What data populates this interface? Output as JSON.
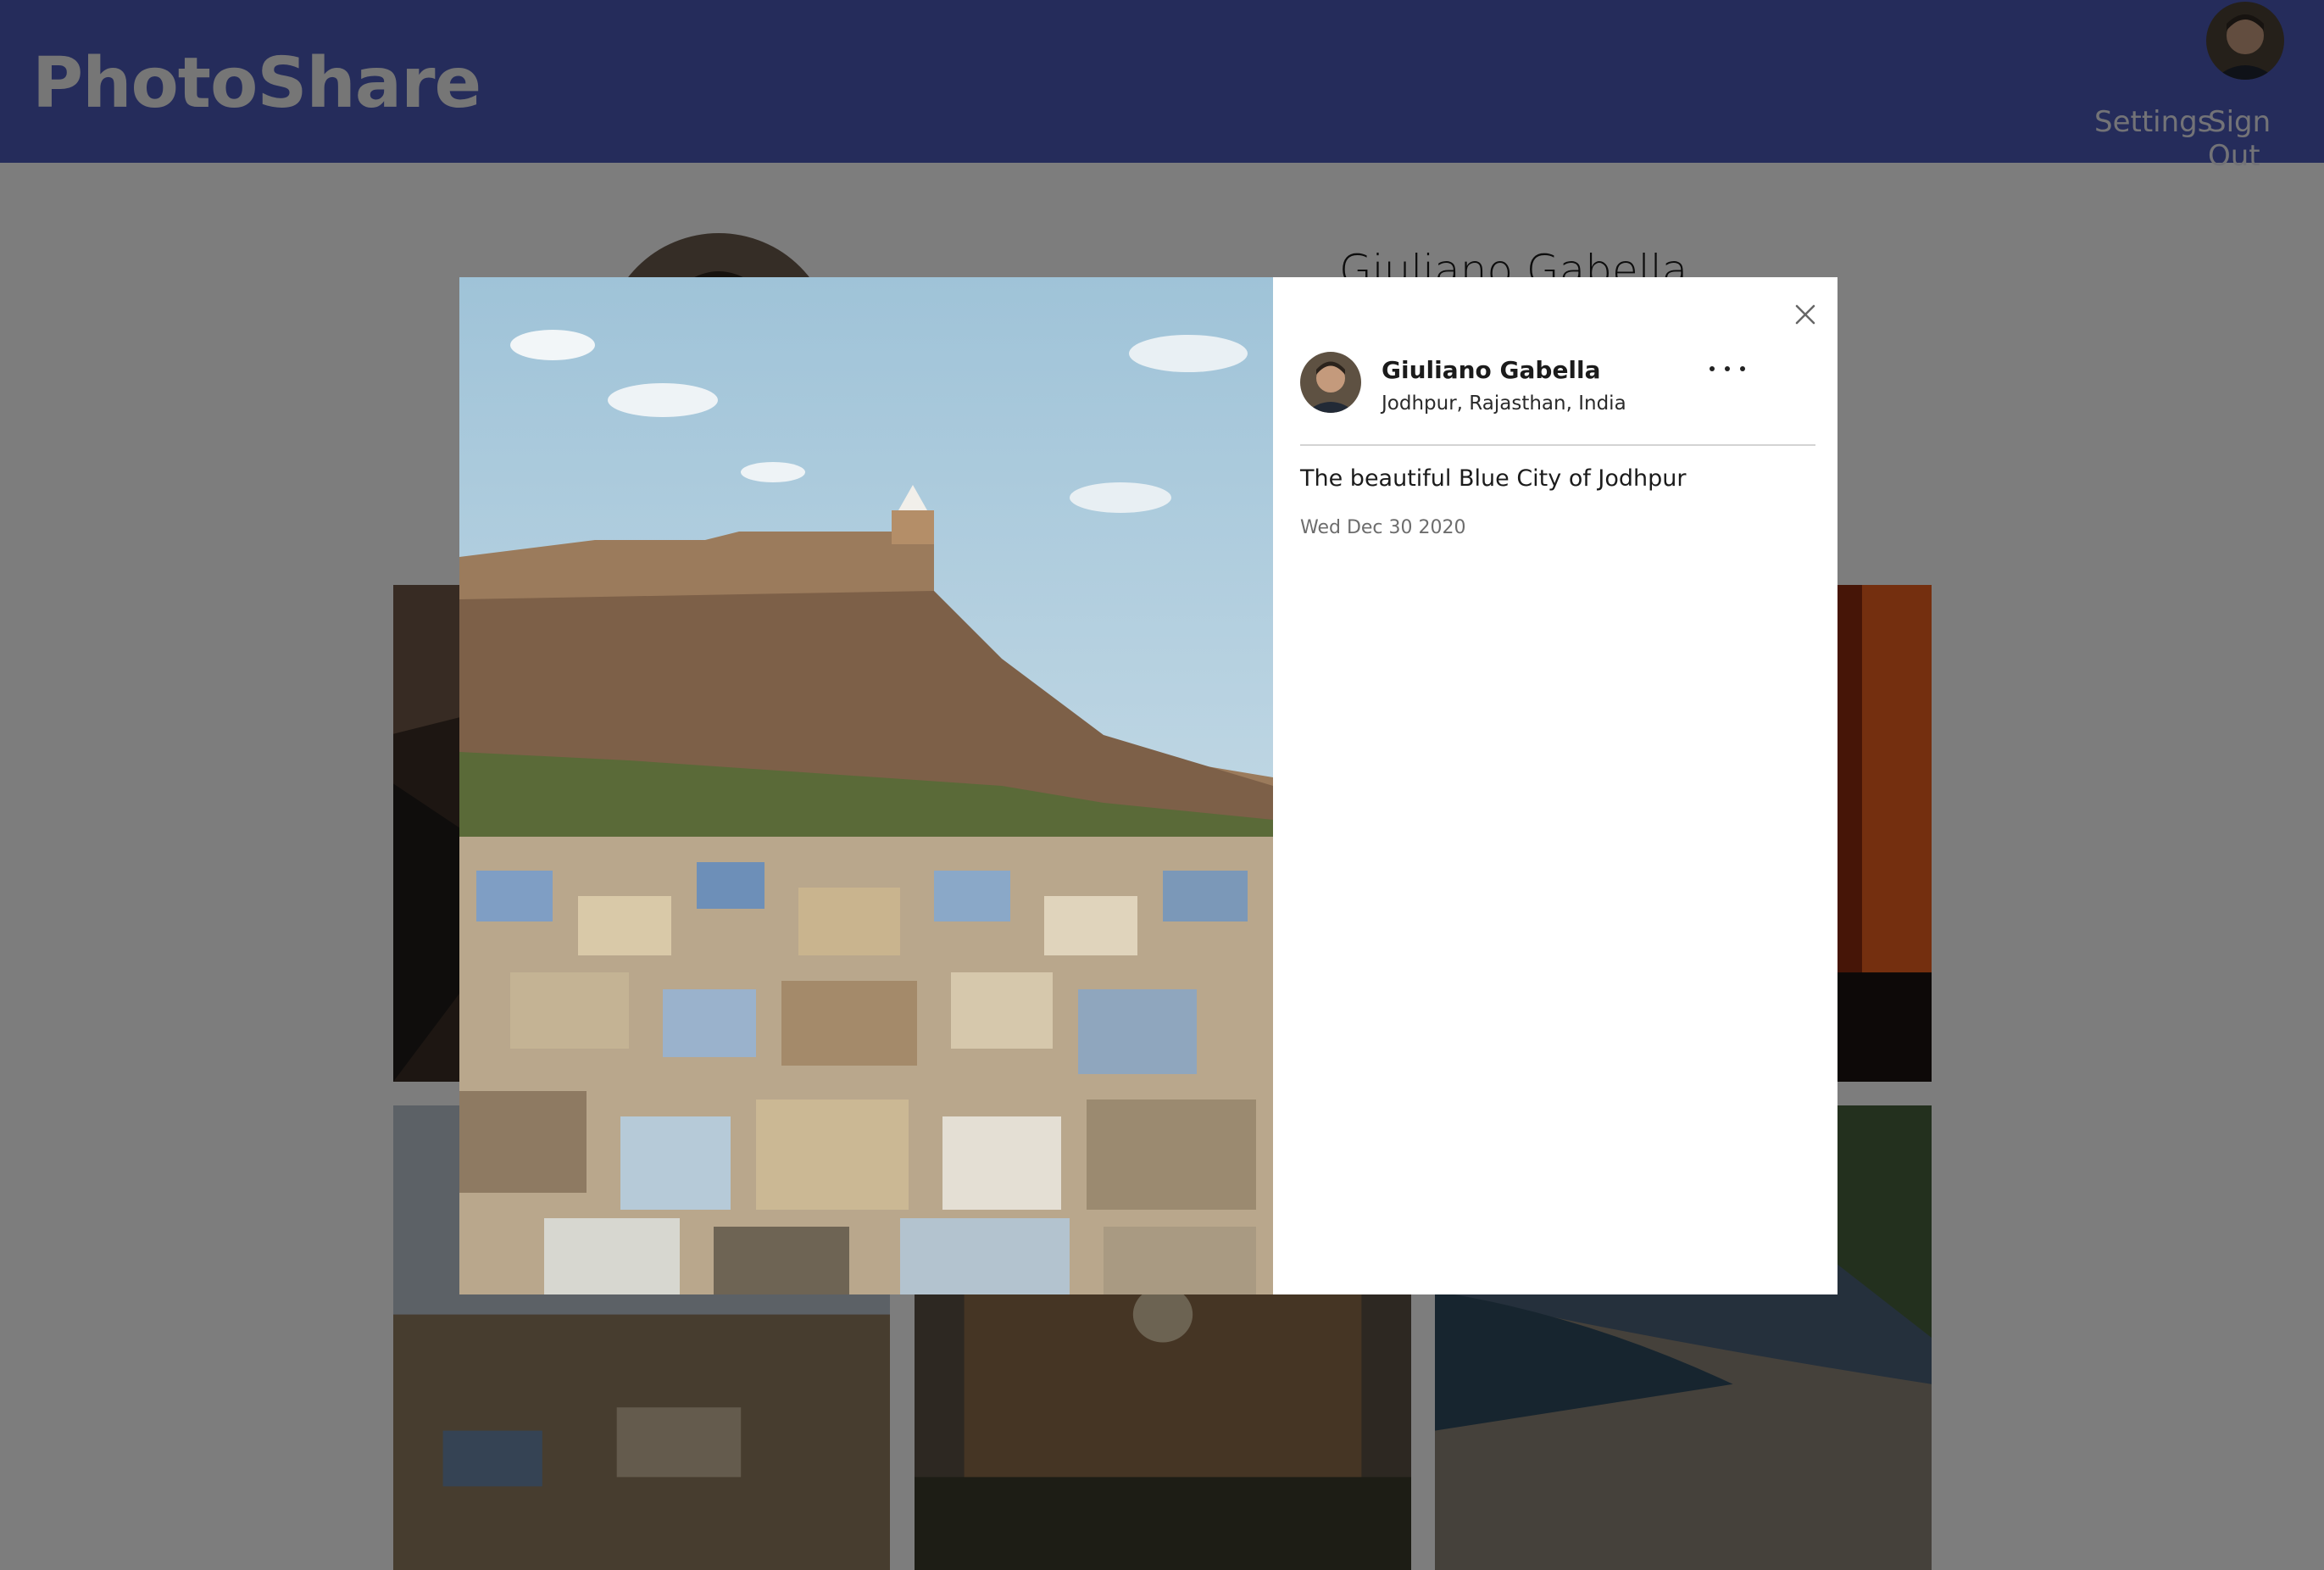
{
  "header": {
    "brand": "PhotoShare",
    "nav": {
      "settings": "Settings",
      "sign_out": "Sign Out"
    },
    "avatar_icon": "user-avatar"
  },
  "profile": {
    "name": "Giuliano Gabella"
  },
  "modal": {
    "post": {
      "author": "Giuliano Gabella",
      "location": "Jodhpur, Rajasthan, India",
      "caption": "The beautiful Blue City of Jodhpur",
      "date": "Wed Dec 30 2020"
    },
    "icons": {
      "close": "close-icon",
      "more": "more-options-icon"
    }
  },
  "colors": {
    "header_bg": "#4a58b7",
    "overlay": "rgba(0,0,0,0.5)",
    "panel_bg": "#ffffff"
  }
}
